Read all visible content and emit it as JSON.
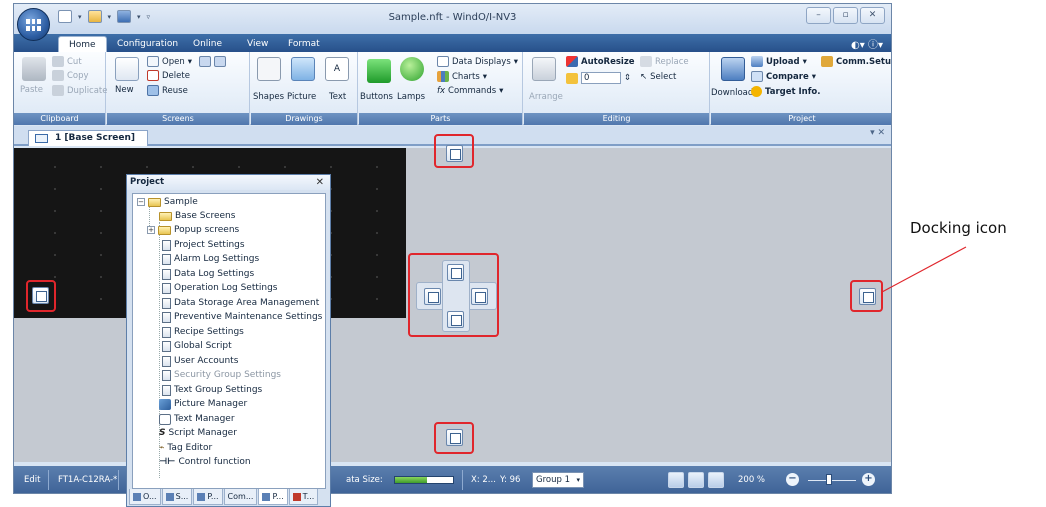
{
  "window": {
    "title": "Sample.nft - WindO/I-NV3"
  },
  "ribbon_tabs": [
    "Home",
    "Configuration",
    "Online",
    "View",
    "Format"
  ],
  "clipboard": {
    "paste": "Paste",
    "cut": "Cut",
    "copy": "Copy",
    "duplicate": "Duplicate",
    "label": "Clipboard"
  },
  "screens": {
    "new": "New",
    "open": "Open",
    "delete": "Delete",
    "reuse": "Reuse",
    "label": "Screens"
  },
  "drawings": {
    "shapes": "Shapes",
    "picture": "Picture",
    "text": "Text",
    "label": "Drawings"
  },
  "parts": {
    "buttons": "Buttons",
    "lamps": "Lamps",
    "data_displays": "Data Displays",
    "charts": "Charts",
    "commands": "Commands",
    "label": "Parts"
  },
  "editing": {
    "arrange": "Arrange",
    "autoresize": "AutoResize",
    "replace": "Replace",
    "select": "Select",
    "spin_value": "0",
    "label": "Editing"
  },
  "project_grp": {
    "download": "Download",
    "upload": "Upload",
    "compare": "Compare",
    "target_info": "Target Info.",
    "comm_setup": "Comm.Setup",
    "label": "Project"
  },
  "doc_tab": {
    "label": "1  [Base Screen]"
  },
  "project_panel": {
    "title": "Project",
    "root": "Sample",
    "items": [
      "Base Screens",
      "Popup screens",
      "Project Settings",
      "Alarm Log Settings",
      "Data Log Settings",
      "Operation Log Settings",
      "Data Storage Area Management",
      "Preventive Maintenance Settings",
      "Recipe Settings",
      "Global Script",
      "User Accounts",
      "Security Group Settings",
      "Text Group Settings",
      "Picture Manager",
      "Text Manager",
      "Script Manager",
      "Tag Editor",
      "Control function"
    ],
    "tabs": [
      "O...",
      "S...",
      "P...",
      "Com...",
      "P...",
      "T..."
    ]
  },
  "statusbar": {
    "mode": "Edit",
    "model": "FT1A-C12RA-*",
    "model2": "M",
    "data_size_label": "ata Size:",
    "data_size_fraction": 0.55,
    "x": "X: 2...",
    "y": "Y: 96",
    "group": "Group 1",
    "zoom": "200 %"
  },
  "annotation": {
    "callout": "Docking icon",
    "color": "#e0262c"
  }
}
